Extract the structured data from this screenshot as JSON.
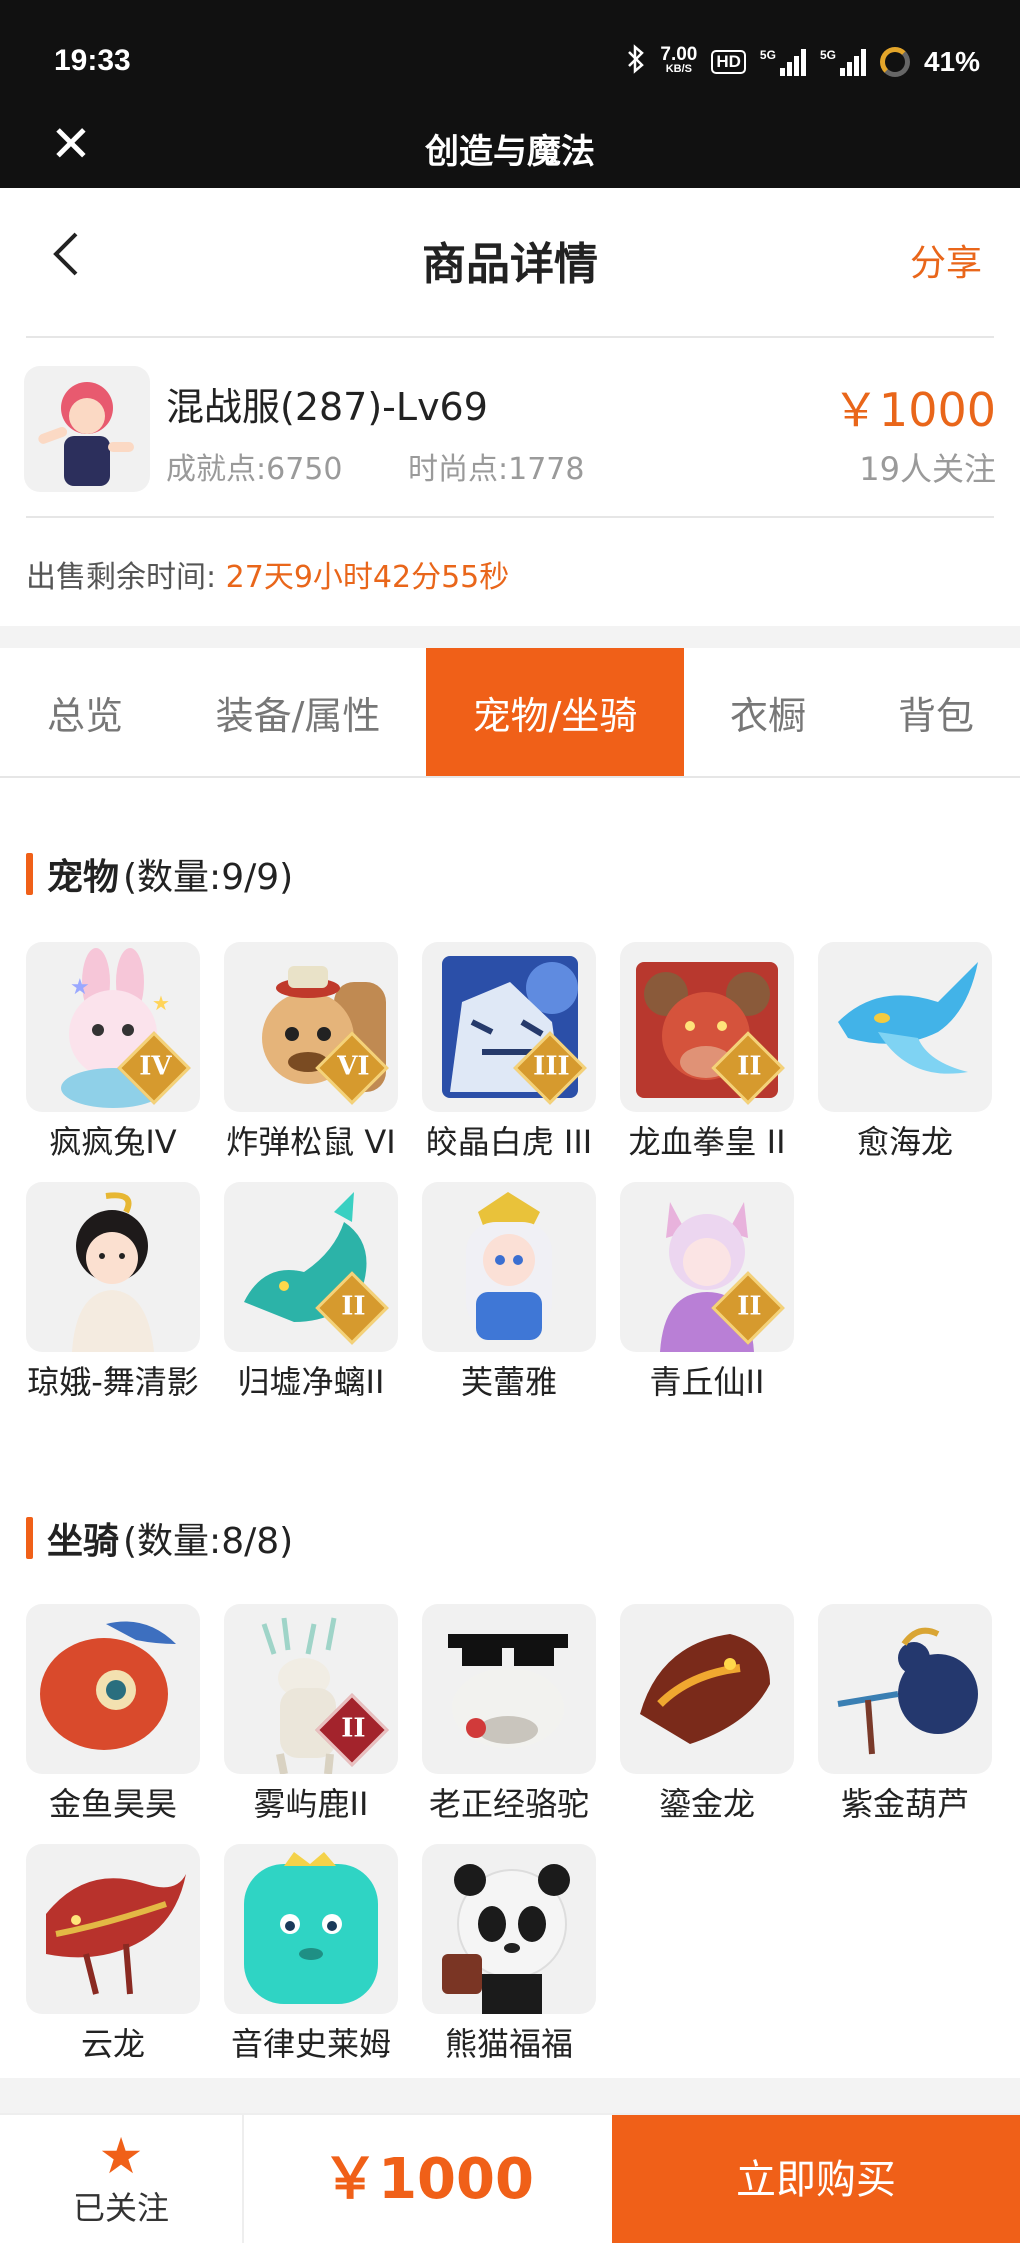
{
  "status_bar": {
    "time": "19:33",
    "net_speed": "7.00",
    "net_unit": "KB/S",
    "hd": "HD",
    "sig1": "5G",
    "sig2": "5G",
    "battery": "41%"
  },
  "app_bar": {
    "title": "创造与魔法"
  },
  "header": {
    "title": "商品详情",
    "share": "分享"
  },
  "product": {
    "name": "混战服(287)-Lv69",
    "achievement": "成就点:6750",
    "fashion": "时尚点:1778",
    "price": "￥1000",
    "followers": "19人关注",
    "remain_label": "出售剩余时间:",
    "remain_value": "27天9小时42分55秒"
  },
  "tabs": [
    "总览",
    "装备/属性",
    "宠物/坐骑",
    "衣橱",
    "背包"
  ],
  "pets": {
    "title": "宠物",
    "count": "(数量:9/9)",
    "items": [
      "疯疯兔IV",
      "炸弹松鼠 VI",
      "皎晶白虎 III",
      "龙血拳皇 II",
      "愈海龙",
      "琼娥-舞清影",
      "归墟净螭II",
      "芙蕾雅",
      "青丘仙II"
    ]
  },
  "mounts": {
    "title": "坐骑",
    "count": "(数量:8/8)",
    "items": [
      "金鱼昊昊",
      "雾屿鹿II",
      "老正经骆驼",
      "鎏金龙",
      "紫金葫芦",
      "云龙",
      "音律史莱姆",
      "熊猫福福"
    ]
  },
  "badges": {
    "iv": "IV",
    "vi": "VI",
    "iii": "III",
    "ii": "II"
  },
  "bottom": {
    "follow_label": "已关注",
    "price": "￥1000",
    "buy": "立即购买"
  },
  "colors": {
    "accent": "#f06018",
    "price": "#e9661a",
    "topbar": "#111111"
  }
}
